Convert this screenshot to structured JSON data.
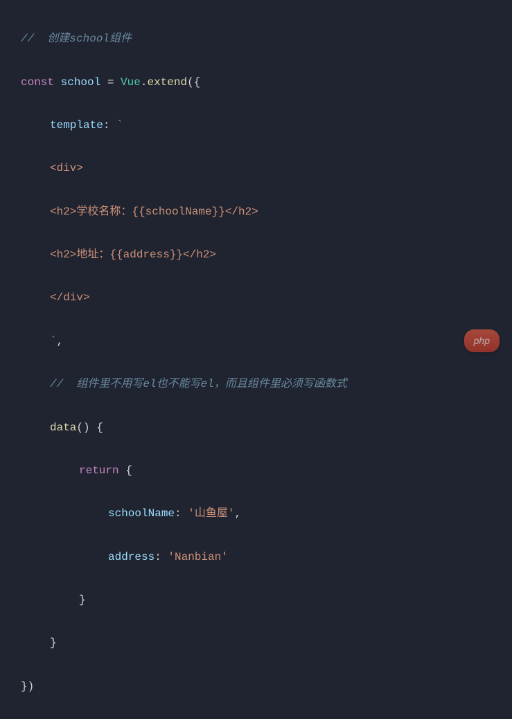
{
  "code": {
    "line1_comment": "//  创建school组件",
    "line2_const": "const",
    "line2_var": "school",
    "line2_eq": " = ",
    "line2_class": "Vue",
    "line2_dot": ".",
    "line2_func": "extend",
    "line2_paren": "({",
    "line3_prop": "template",
    "line3_colon": ": ",
    "line3_backtick": "`",
    "line4_tmpl": "<div>",
    "line5_tmpl": "<h2>学校名称：{{schoolName}}</h2>",
    "line6_tmpl": "<h2>地址：{{address}}</h2>",
    "line7_tmpl": "</div>",
    "line8_tmpl": "`",
    "line8_comma": ",",
    "line9_comment": "//  组件里不用写el也不能写el，而且组件里必须写函数式",
    "line10_func": "data",
    "line10_parens": "() {",
    "line11_return": "return",
    "line11_brace": " {",
    "line12_prop": "schoolName",
    "line12_colon": ": ",
    "line12_str": "'山鱼屋'",
    "line12_comma": ",",
    "line13_prop": "address",
    "line13_colon": ": ",
    "line13_str": "'Nanbian'",
    "line14_brace": "}",
    "line15_brace": "}",
    "line16_close": "})"
  },
  "watermark": "php"
}
